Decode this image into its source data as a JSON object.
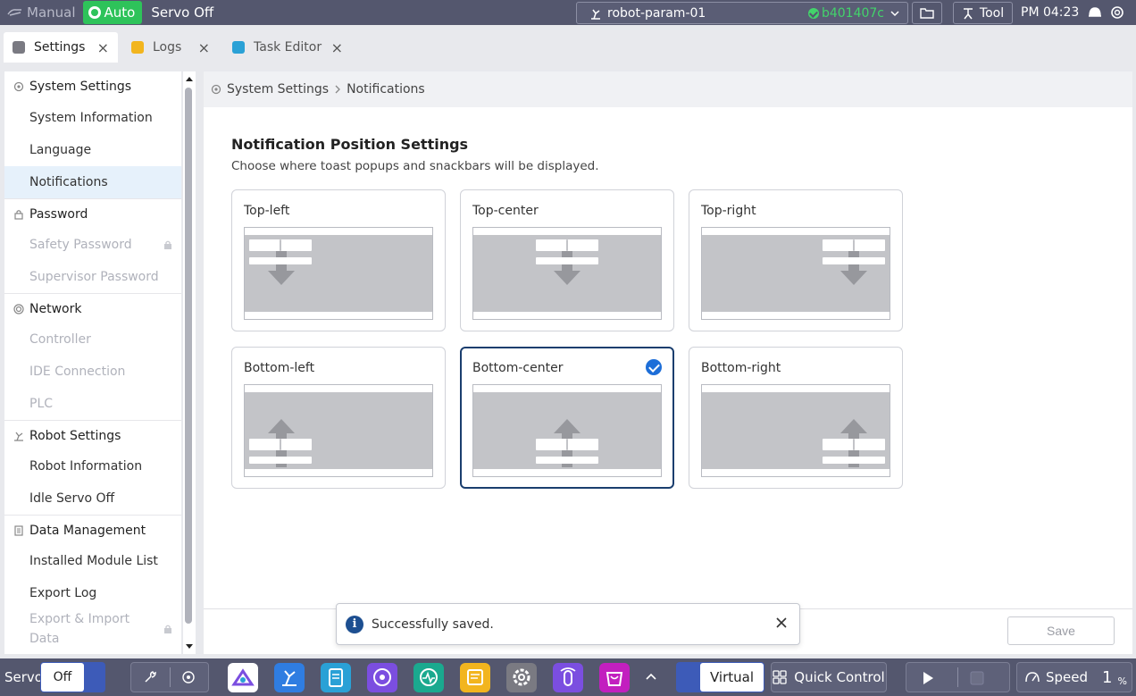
{
  "topbar": {
    "mode_manual": "Manual",
    "mode_auto": "Auto",
    "servo_status": "Servo Off",
    "robot_name": "robot-param-01",
    "robot_hash": "b401407c",
    "tool_label": "Tool",
    "clock": "PM 04:23"
  },
  "tabs": [
    {
      "label": "Settings",
      "color": "#7a7a82"
    },
    {
      "label": "Logs",
      "color": "#f2b51e"
    },
    {
      "label": "Task Editor",
      "color": "#2aa1d6"
    }
  ],
  "sidebar": {
    "groups": [
      {
        "label": "System Settings",
        "icon": "gear-icon",
        "items": [
          {
            "label": "System Information"
          },
          {
            "label": "Language"
          },
          {
            "label": "Notifications"
          }
        ]
      },
      {
        "label": "Password",
        "icon": "lock-icon",
        "items": [
          {
            "label": "Safety Password"
          },
          {
            "label": "Supervisor Password"
          }
        ]
      },
      {
        "label": "Network",
        "icon": "network-icon",
        "items": [
          {
            "label": "Controller"
          },
          {
            "label": "IDE Connection"
          },
          {
            "label": "PLC"
          }
        ]
      },
      {
        "label": "Robot Settings",
        "icon": "robot-arm-icon",
        "items": [
          {
            "label": "Robot Information"
          },
          {
            "label": "Idle Servo Off"
          }
        ]
      },
      {
        "label": "Data Management",
        "icon": "document-icon",
        "items": [
          {
            "label": "Installed Module List"
          },
          {
            "label": "Export Log"
          },
          {
            "label": "Export & Import Data"
          }
        ]
      }
    ]
  },
  "breadcrumb": {
    "root": "System Settings",
    "current": "Notifications"
  },
  "content": {
    "title": "Notification Position Settings",
    "subtitle": "Choose where toast popups and snackbars will be displayed.",
    "options": [
      {
        "label": "Top-left"
      },
      {
        "label": "Top-center"
      },
      {
        "label": "Top-right"
      },
      {
        "label": "Bottom-left"
      },
      {
        "label": "Bottom-center"
      },
      {
        "label": "Bottom-right"
      }
    ],
    "selected": "Bottom-center"
  },
  "save_label": "Save",
  "toast": {
    "message": "Successfully saved."
  },
  "bottombar": {
    "servo_label": "Servo",
    "servo_value": "Off",
    "virtual_label": "Virtual",
    "quick_control_label": "Quick Control",
    "speed_label": "Speed",
    "speed_value": "1",
    "speed_unit": "%"
  },
  "colors": {
    "accent": "#1d6ed8",
    "auto_green": "#2ec35a",
    "bar": "#54576e"
  }
}
